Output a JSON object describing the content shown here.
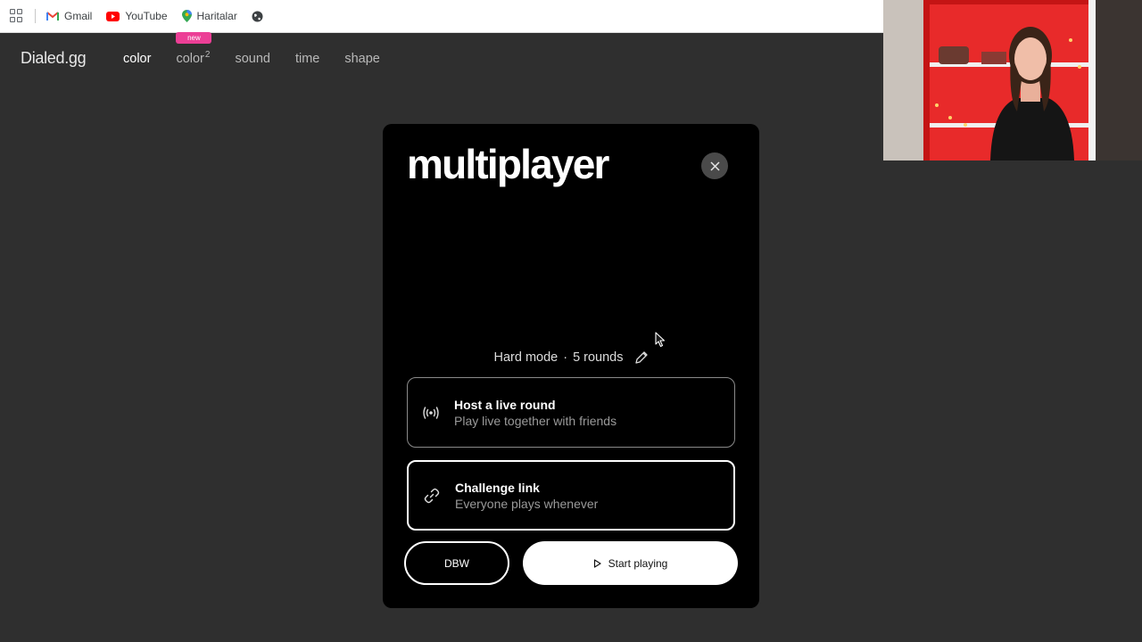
{
  "bookmarks": {
    "items": [
      {
        "label": "Gmail",
        "icon": "gmail-icon"
      },
      {
        "label": "YouTube",
        "icon": "youtube-icon"
      },
      {
        "label": "Haritalar",
        "icon": "maps-icon"
      }
    ],
    "extra_icon": "globe-icon",
    "apps_icon": "apps-grid-icon"
  },
  "site": {
    "logo": "Dialed.gg",
    "nav": [
      {
        "label": "color",
        "active": true
      },
      {
        "label": "color",
        "sup": "2",
        "badge": "new"
      },
      {
        "label": "sound"
      },
      {
        "label": "time"
      },
      {
        "label": "shape"
      }
    ]
  },
  "modal": {
    "title": "multiplayer",
    "close_icon": "close-icon",
    "mode": "Hard mode",
    "separator": "·",
    "rounds": "5 rounds",
    "options": [
      {
        "title": "Host a live round",
        "subtitle": "Play live together with friends",
        "icon": "broadcast-icon"
      },
      {
        "title": "Challenge link",
        "subtitle": "Everyone plays whenever",
        "icon": "link-icon"
      }
    ],
    "name_button": "DBW",
    "start_button": "Start playing"
  },
  "colors": {
    "background": "#2f2f2f",
    "modal": "#000000",
    "badge": "#ec3f96"
  }
}
